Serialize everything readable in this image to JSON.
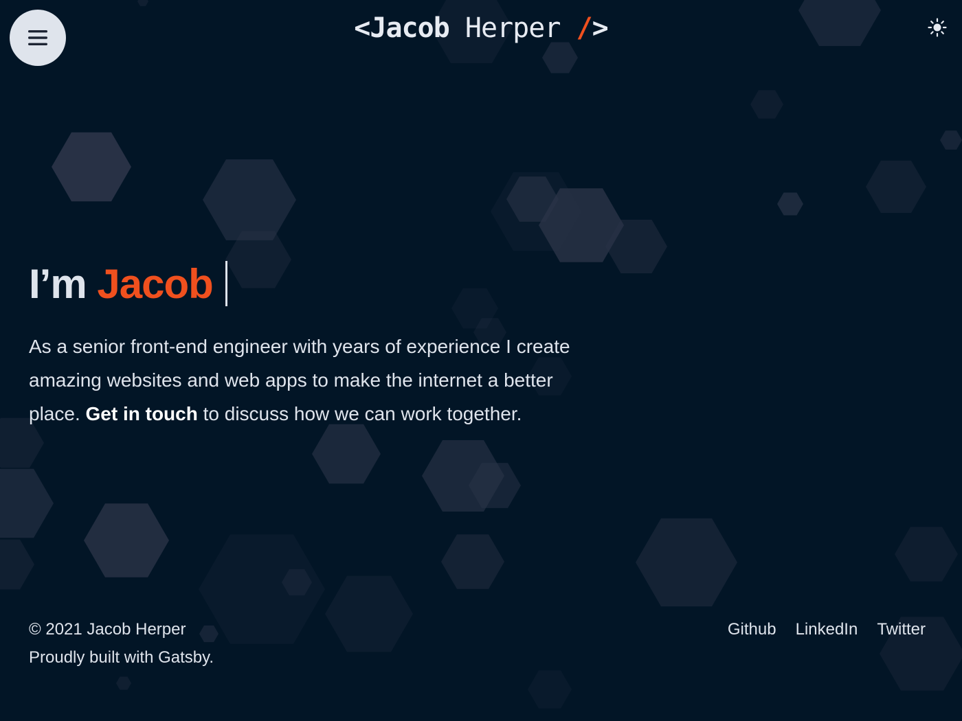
{
  "header": {
    "logo": {
      "open": "<",
      "first": "Jacob",
      "last": "Herper",
      "slash": "/",
      "close": ">"
    },
    "menu_icon": "hamburger-icon",
    "theme_icon": "sun-icon"
  },
  "hero": {
    "greeting": "I’m",
    "name": "Jacob",
    "intro": "As a senior front-end engineer with years of experience I create amazing websites and web apps to make the internet a better place.",
    "cta": "Get in touch",
    "outro": "to discuss how we can work together."
  },
  "footer": {
    "copyright": "© 2021 Jacob Herper",
    "built_with": "Proudly built with Gatsby.",
    "links": [
      "Github",
      "LinkedIn",
      "Twitter"
    ]
  },
  "colors": {
    "background": "#021526",
    "accent": "#f0501e",
    "text": "#dfe4ec",
    "hexagon": "#2a3347"
  }
}
